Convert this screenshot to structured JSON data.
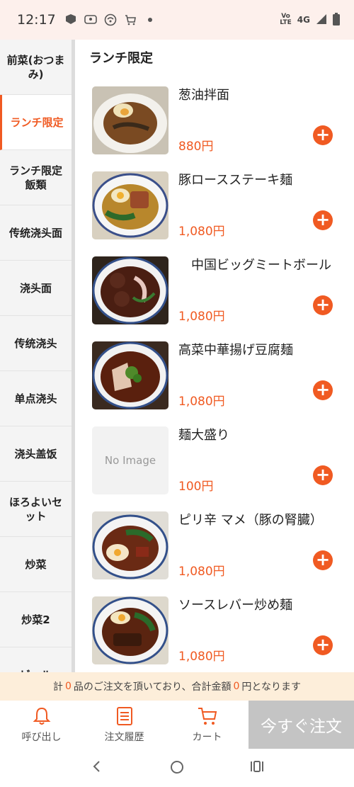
{
  "status": {
    "time": "12:17",
    "volte": "Vo\nLTE",
    "network": "4G"
  },
  "sidebar": {
    "items": [
      {
        "label": "前菜(おつまみ)"
      },
      {
        "label": "ランチ限定"
      },
      {
        "label": "ランチ限定飯類"
      },
      {
        "label": "传统浇头面"
      },
      {
        "label": "浇头面"
      },
      {
        "label": "传统浇头"
      },
      {
        "label": "单点浇头"
      },
      {
        "label": "浇头盖饭"
      },
      {
        "label": "ほろよいセット"
      },
      {
        "label": "炒菜"
      },
      {
        "label": "炒菜2"
      },
      {
        "label": "ビール"
      }
    ],
    "active_index": 1
  },
  "main": {
    "category_title": "ランチ限定",
    "items": [
      {
        "name": "葱油拌面",
        "price": "880円",
        "image": "noodle-bowl-egg"
      },
      {
        "name": "豚ロースステーキ麺",
        "price": "1,080円",
        "image": "noodle-bowl-pork"
      },
      {
        "name": "　中国ビッグミートボール",
        "price": "1,080円",
        "image": "noodle-bowl-meatball"
      },
      {
        "name": "高菜中華揚げ豆腐麺",
        "price": "1,080円",
        "image": "noodle-bowl-tofu"
      },
      {
        "name": "麺大盛り",
        "price": "100円",
        "image": "no-image",
        "no_image_text": "No Image"
      },
      {
        "name": "ピリ辛 マメ（豚の腎臓）",
        "price": "1,080円",
        "image": "noodle-bowl-kidney"
      },
      {
        "name": "ソースレバー炒め麺",
        "price": "1,080円",
        "image": "noodle-bowl-liver"
      }
    ],
    "add_symbol": "+"
  },
  "summary": {
    "prefix": "計",
    "count": "0",
    "middle": "品のご注文を頂いており、合計金額",
    "amount": "0",
    "suffix": "円となります"
  },
  "bottom_nav": {
    "call_label": "呼び出し",
    "history_label": "注文履歴",
    "cart_label": "カート",
    "order_now_label": "今すぐ注文"
  },
  "colors": {
    "accent": "#f05a22",
    "summary_bg": "#fdeeda",
    "status_bg": "#fdf0ec",
    "order_btn_bg": "#c4c4c4"
  }
}
